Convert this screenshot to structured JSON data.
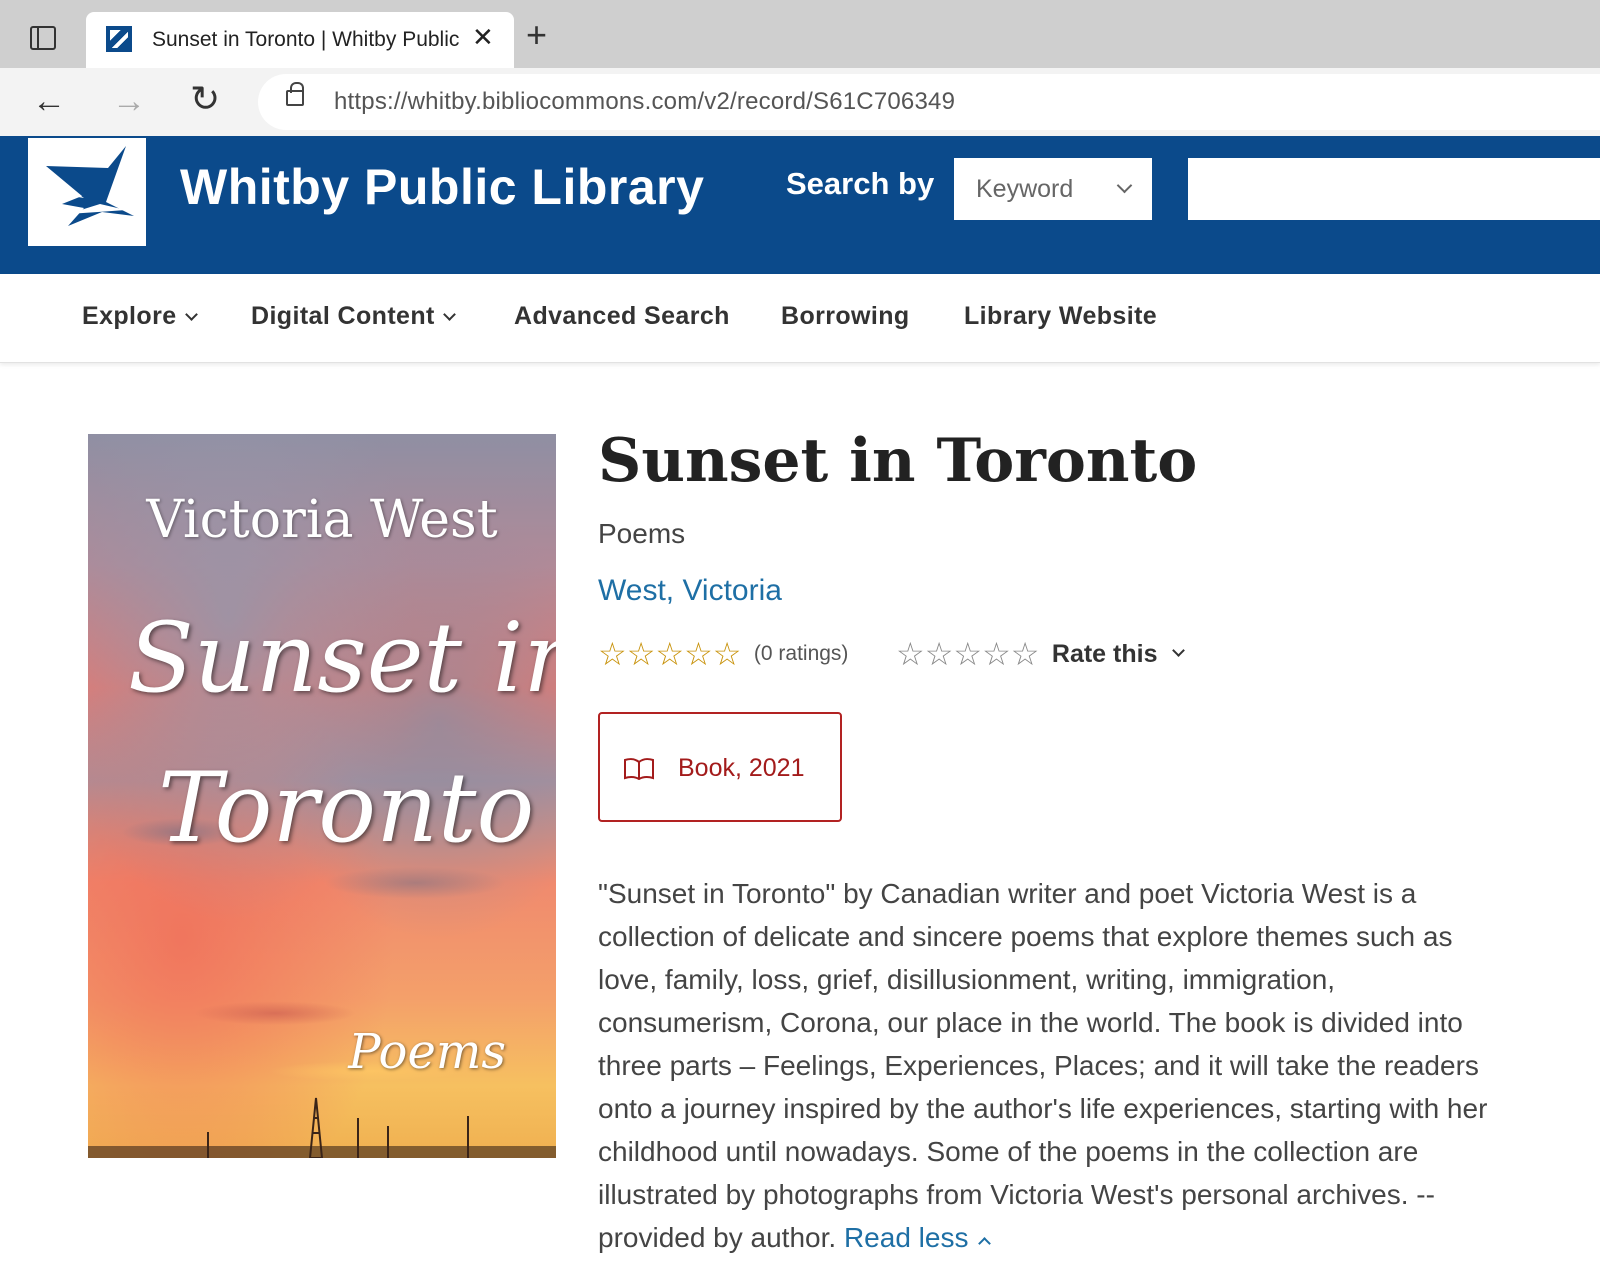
{
  "browser": {
    "tab_title": "Sunset in Toronto | Whitby Public",
    "url": "https://whitby.bibliocommons.com/v2/record/S61C706349"
  },
  "header": {
    "library_name": "Whitby Public Library",
    "search_by_label": "Search by",
    "search_type": "Keyword",
    "search_value": ""
  },
  "nav": {
    "items": [
      {
        "label": "Explore"
      },
      {
        "label": "Digital Content"
      },
      {
        "label": "Advanced Search"
      },
      {
        "label": "Borrowing"
      },
      {
        "label": "Library Website"
      }
    ]
  },
  "cover": {
    "author": "Victoria West",
    "title_line1": "Sunset in",
    "title_line2": "Toronto",
    "subtitle": "Poems"
  },
  "record": {
    "title": "Sunset in Toronto",
    "subtitle": "Poems",
    "author": "West, Victoria",
    "average_rating": 0,
    "rating_count_text": "(0 ratings)",
    "rate_label": "Rate this",
    "format": "Book, 2021",
    "description": "\"Sunset in Toronto\" by Canadian writer and poet Victoria West is a collection of delicate and sincere poems that explore themes such as love, family, loss, grief, disillusionment, writing, immigration, consumerism, Corona, our place in the world. The book is divided into three parts – Feelings, Experiences, Places; and it will take the readers onto a journey inspired by the author's life experiences, starting with her childhood until nowadays. Some of the poems in the collection are illustrated by photographs from Victoria West's personal archives. -- provided by author.",
    "read_less_label": "Read less"
  },
  "colors": {
    "brand_blue": "#0b4a8b",
    "link_blue": "#1e6fa5",
    "format_red": "#b22222",
    "star_gold": "#c8920a"
  }
}
